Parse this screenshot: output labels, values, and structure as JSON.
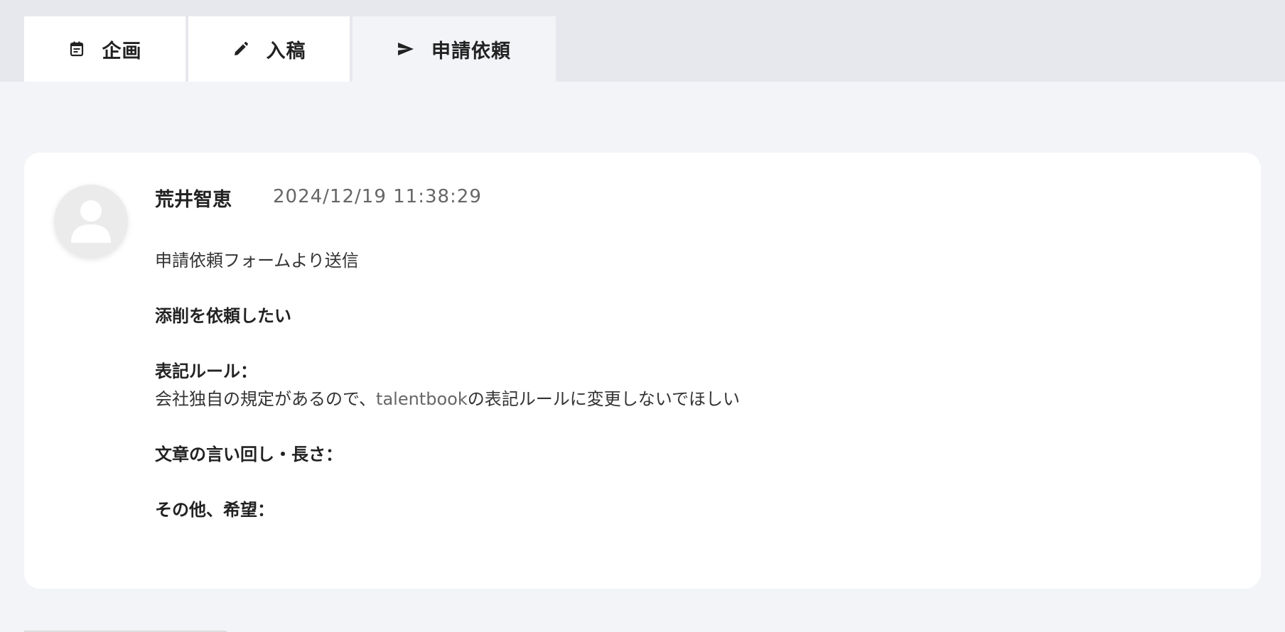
{
  "tabs": [
    {
      "label": "企画",
      "icon": "calendar-note-icon"
    },
    {
      "label": "入稿",
      "icon": "pencil-icon"
    },
    {
      "label": "申請依頼",
      "icon": "send-icon"
    }
  ],
  "comment": {
    "author": "荒井智恵",
    "timestamp": "2024/12/19 11:38:29",
    "line1": "申請依頼フォームより送信",
    "line2": "添削を依頼したい",
    "rule_heading": "表記ルール：",
    "rule_text_1": "会社独自の規定があるので、",
    "rule_text_brand": "talentbook",
    "rule_text_2": "の表記ルールに変更しないでほしい",
    "style_heading": "文章の言い回し・長さ：",
    "other_heading": "その他、希望："
  },
  "colors": {
    "page_bg": "#f3f4f8",
    "tabbar_bg": "#e7e8ed",
    "card_bg": "#ffffff",
    "text": "#222222",
    "muted": "#666666"
  }
}
